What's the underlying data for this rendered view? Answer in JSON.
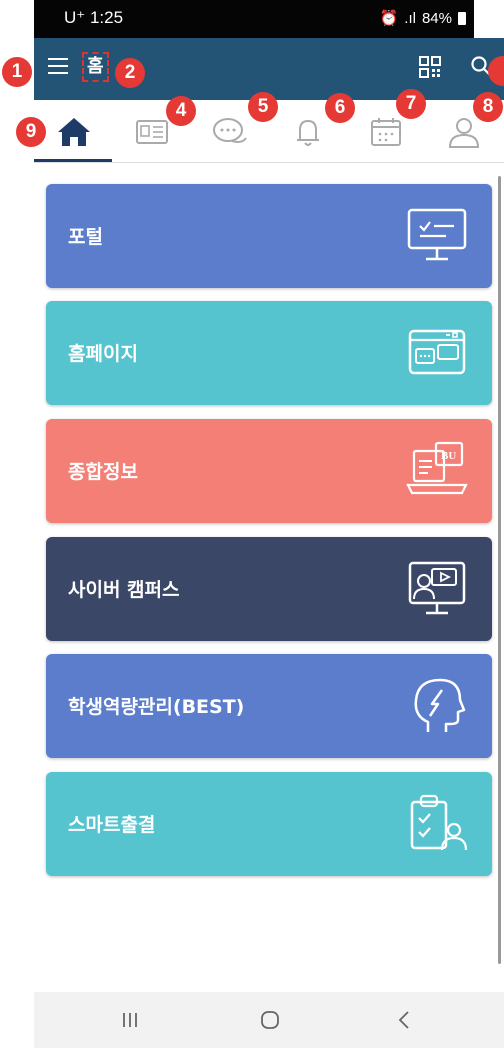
{
  "status": {
    "carrier": "U⁺ 1:25",
    "battery": "84%"
  },
  "header": {
    "title": "홈"
  },
  "badges": [
    "1",
    "2",
    "4",
    "5",
    "6",
    "7",
    "8",
    "9"
  ],
  "cards": [
    {
      "label": "포털",
      "color": "#5b7dcc",
      "icon": "monitor-checklist-icon"
    },
    {
      "label": "홈페이지",
      "color": "#55c4cf",
      "icon": "browser-window-icon"
    },
    {
      "label": "종합정보",
      "color": "#f47f76",
      "icon": "laptop-bu-icon"
    },
    {
      "label": "사이버 캠퍼스",
      "color": "#3a4767",
      "icon": "video-lecture-icon"
    },
    {
      "label": "학생역량관리(BEST)",
      "color": "#5b7dcc",
      "icon": "head-lightning-icon"
    },
    {
      "label": "스마트출결",
      "color": "#55c4cf",
      "icon": "attendance-clipboard-icon"
    }
  ],
  "tabs": [
    {
      "name": "home",
      "icon": "home-icon",
      "active": true
    },
    {
      "name": "id-card",
      "icon": "id-card-icon"
    },
    {
      "name": "chat",
      "icon": "chat-icon"
    },
    {
      "name": "notifications",
      "icon": "bell-icon"
    },
    {
      "name": "calendar",
      "icon": "calendar-icon"
    },
    {
      "name": "profile",
      "icon": "person-icon"
    }
  ]
}
